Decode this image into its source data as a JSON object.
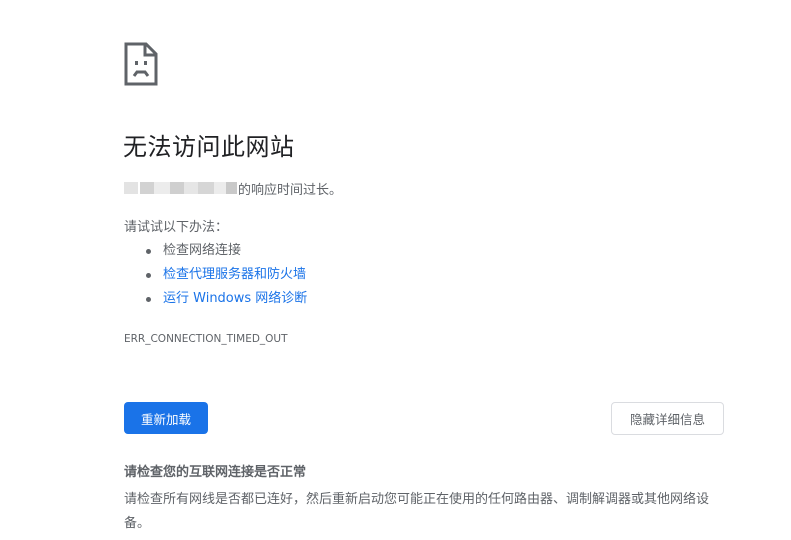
{
  "error_page": {
    "icon": "sad-page-icon",
    "title": "无法访问此网站",
    "summary_suffix": "的响应时间过长。",
    "tips_heading": "请试试以下办法：",
    "suggestions": [
      {
        "label": "检查网络连接",
        "is_link": false
      },
      {
        "label": "检查代理服务器和防火墙",
        "is_link": true
      },
      {
        "label": "运行 Windows 网络诊断",
        "is_link": true
      }
    ],
    "error_code": "ERR_CONNECTION_TIMED_OUT",
    "reload_label": "重新加载",
    "details_label": "隐藏详细信息",
    "details": {
      "heading": "请检查您的互联网连接是否正常",
      "body": "请检查所有网线是否都已连好，然后重新启动您可能正在使用的任何路由器、调制解调器或其他网络设备。"
    }
  },
  "colors": {
    "accent": "#1a73e8",
    "text_primary": "#202124",
    "text_secondary": "#5f6368",
    "border": "#dadce0"
  }
}
